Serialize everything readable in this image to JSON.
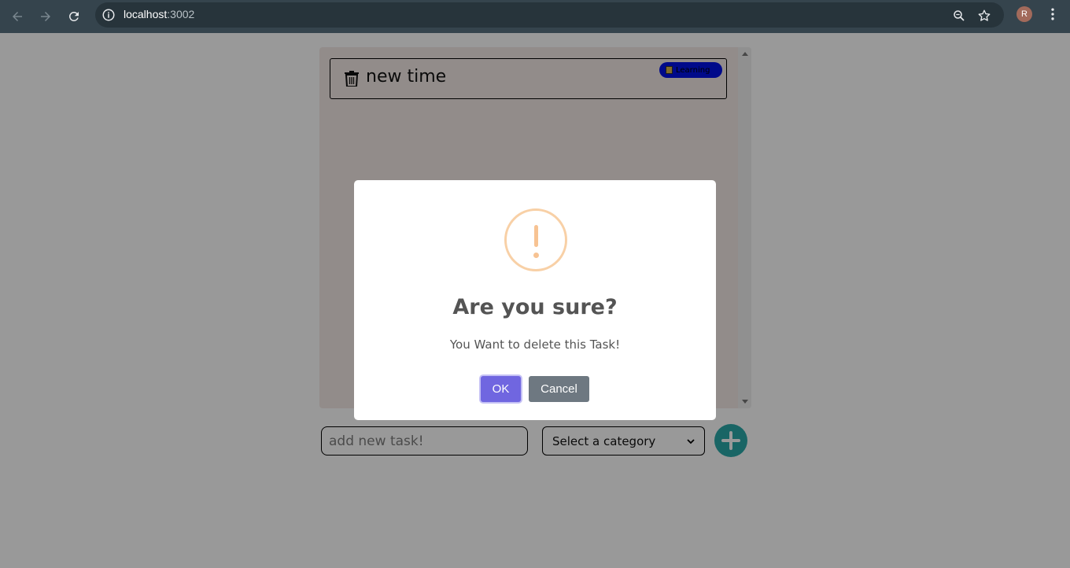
{
  "browser": {
    "url_host": "localhost",
    "url_port": ":3002",
    "profile_initial": "R"
  },
  "tasks": [
    {
      "title": "new time",
      "category": "Learning"
    }
  ],
  "form": {
    "placeholder": "add new task!",
    "select_value": "Select a category"
  },
  "dialog": {
    "title": "Are you sure?",
    "text": "You Want to delete this Task!",
    "ok_label": "OK",
    "cancel_label": "Cancel"
  },
  "colors": {
    "ok": "#7066e0",
    "cancel": "#6e7881",
    "warning": "#f8bb86",
    "badge": "#0011e6",
    "add_button": "#2aa8a8"
  }
}
